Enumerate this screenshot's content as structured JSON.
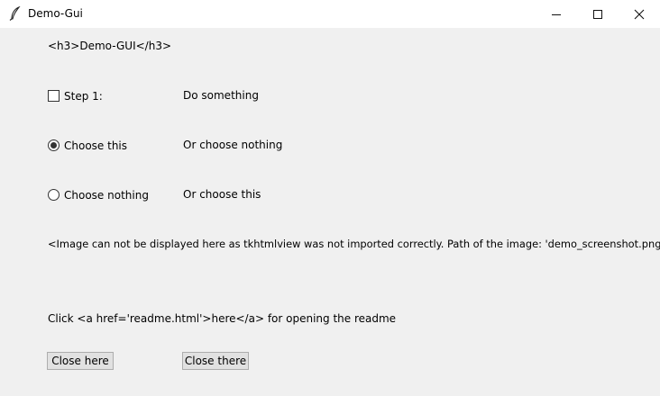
{
  "window": {
    "title": "Demo-Gui",
    "minimize_icon": "minimize-icon",
    "maximize_icon": "maximize-icon",
    "close_icon": "close-icon",
    "app_icon": "feather-icon"
  },
  "content": {
    "heading": "<h3>Demo-GUI</h3>",
    "step1": {
      "label": "Step 1:",
      "checked": false,
      "description": "Do something"
    },
    "radio_this": {
      "label": "Choose this",
      "selected": true,
      "description": "Or choose nothing"
    },
    "radio_nothing": {
      "label": "Choose nothing",
      "selected": false,
      "description": "Or choose this"
    },
    "image_notice": "<Image can not be displayed here as tkhtmlview was not imported correctly. Path of the image: 'demo_screenshot.png'>",
    "readme_text": "Click <a href='readme.html'>here</a> for opening the readme"
  },
  "buttons": {
    "close_here": "Close here",
    "close_there": "Close there"
  }
}
